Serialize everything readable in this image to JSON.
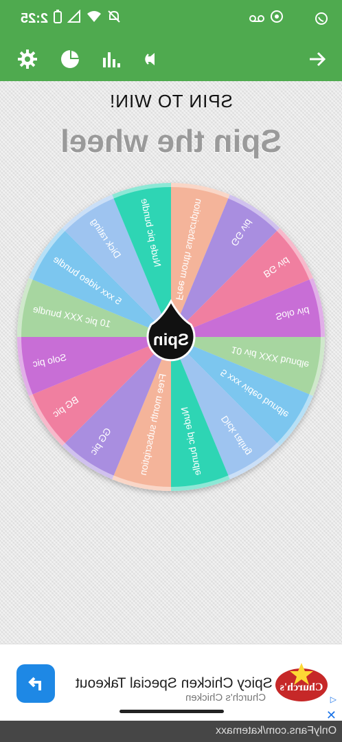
{
  "status_bar": {
    "time": "2:25",
    "right_icons": [
      "voicemail-icon",
      "vpn-icon",
      "whatsapp-icon"
    ],
    "left_icons": [
      "battery-icon",
      "signal-icon",
      "wifi-icon",
      "mute-icon"
    ]
  },
  "toolbar": {
    "icons": [
      "gear-icon",
      "pie-chart-icon",
      "bar-chart-icon",
      "sound-icon",
      "arrow-right-icon"
    ]
  },
  "title_top": "SPIN TO WIN!",
  "title_big": "Spin the wheel",
  "wheel": {
    "center_label": "Spin",
    "segments": [
      {
        "label": "Free month subscription",
        "color": "#f4b49a"
      },
      {
        "label": "GG vid",
        "color": "#a98ee0"
      },
      {
        "label": "BG vid",
        "color": "#f07fa0"
      },
      {
        "label": "Solo vid",
        "color": "#c86ed6"
      },
      {
        "label": "10 vid XXX bundle",
        "color": "#a7d6a0"
      },
      {
        "label": "5 xxx video bundle",
        "color": "#7cc6ef"
      },
      {
        "label": "Dick rating",
        "color": "#9ec4f0"
      },
      {
        "label": "Nude pic bundle",
        "color": "#2fd5b4"
      },
      {
        "label": "Free month subscription",
        "color": "#f4b49a"
      },
      {
        "label": "GG pic",
        "color": "#a98ee0"
      },
      {
        "label": "BG pic",
        "color": "#f07fa0"
      },
      {
        "label": "Solo pic",
        "color": "#c86ed6"
      },
      {
        "label": "10 pic XXX bundle",
        "color": "#a7d6a0"
      },
      {
        "label": "5 xxx video bundle",
        "color": "#7cc6ef"
      },
      {
        "label": "Dick rating",
        "color": "#9ec4f0"
      },
      {
        "label": "Nude pic bundle",
        "color": "#2fd5b4"
      }
    ]
  },
  "ad": {
    "title": "Spicy Chicken Special Takeout",
    "subtitle": "Church's Chicken",
    "logo_text": "Church's"
  },
  "bottom_text": "OnlyFans.com/katemaxx"
}
